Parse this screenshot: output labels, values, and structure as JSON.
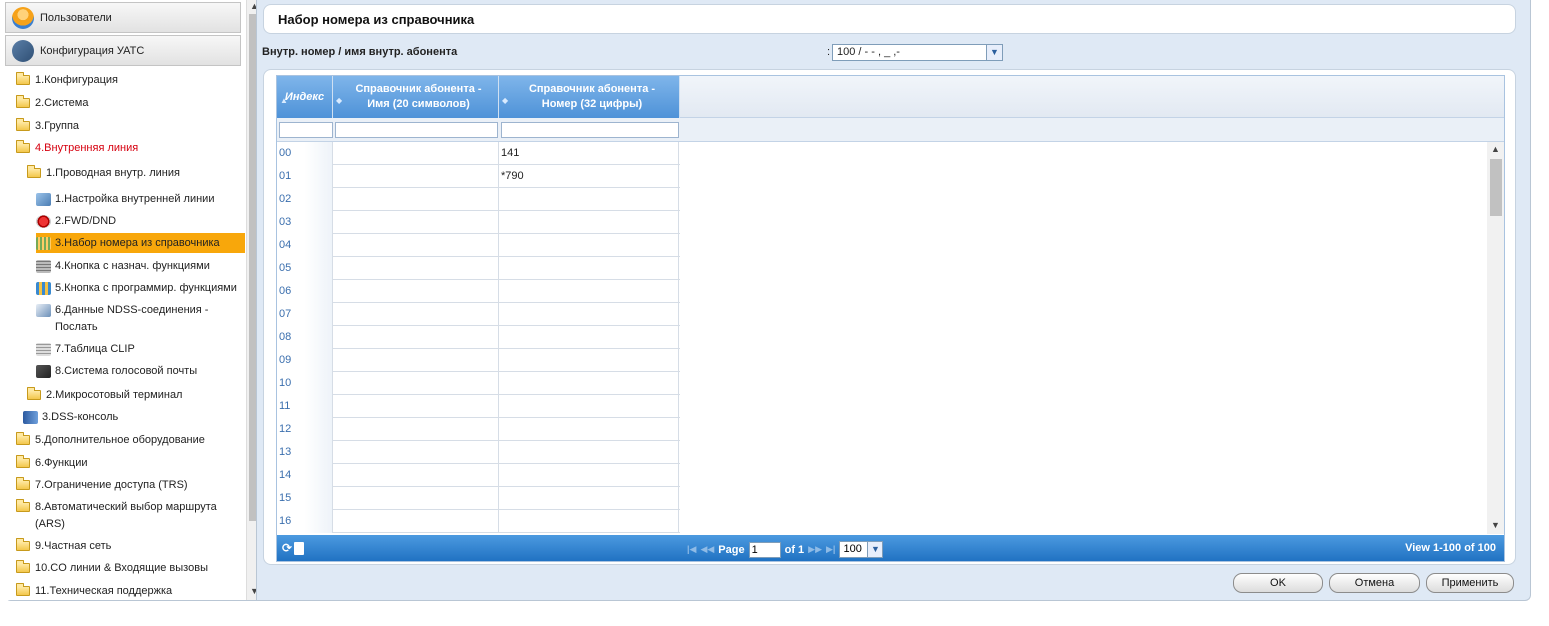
{
  "sidebar": {
    "users_label": "Пользователи",
    "config_label": "Конфигурация УАТС",
    "items": [
      {
        "label": "1.Конфигурация"
      },
      {
        "label": "2.Система"
      },
      {
        "label": "3.Группа"
      },
      {
        "label": "4.Внутренняя линия"
      },
      {
        "label": "1.Проводная внутр. линия"
      },
      {
        "label": "1.Настройка внутренней линии"
      },
      {
        "label": "2.FWD/DND"
      },
      {
        "label": "3.Набор номера из справочника"
      },
      {
        "label": "4.Кнопка с назнач. функциями"
      },
      {
        "label": "5.Кнопка с программир. функциями"
      },
      {
        "label": "6.Данные NDSS-соединения -"
      },
      {
        "label": "Послать"
      },
      {
        "label": "7.Таблица CLIP"
      },
      {
        "label": "8.Система голосовой почты"
      },
      {
        "label": "2.Микросотовый терминал"
      },
      {
        "label": "3.DSS-консоль"
      },
      {
        "label": "5.Дополнительное оборудование"
      },
      {
        "label": "6.Функции"
      },
      {
        "label": "7.Ограничение доступа (TRS)"
      },
      {
        "label": "8.Автоматический выбор маршрута"
      },
      {
        "label": "(ARS)"
      },
      {
        "label": "9.Частная сеть"
      },
      {
        "label": "10.CO линии & Входящие вызовы"
      },
      {
        "label": "11.Техническая поддержка"
      }
    ]
  },
  "page": {
    "title": "Набор номера из справочника",
    "ext_label": "Внутр. номер / имя внутр. абонента",
    "ext_colon": ":",
    "ext_value": "100 / - - ,   _ ,-"
  },
  "grid": {
    "col_index": "Индекс",
    "col_name": "Справочник абонента - Имя (20 символов)",
    "col_number": "Справочник абонента - Номер (32 цифры)",
    "rows": [
      {
        "idx": "00",
        "name": "",
        "num": "141"
      },
      {
        "idx": "01",
        "name": "",
        "num": "*790"
      },
      {
        "idx": "02",
        "name": "",
        "num": ""
      },
      {
        "idx": "03",
        "name": "",
        "num": ""
      },
      {
        "idx": "04",
        "name": "",
        "num": ""
      },
      {
        "idx": "05",
        "name": "",
        "num": ""
      },
      {
        "idx": "06",
        "name": "",
        "num": ""
      },
      {
        "idx": "07",
        "name": "",
        "num": ""
      },
      {
        "idx": "08",
        "name": "",
        "num": ""
      },
      {
        "idx": "09",
        "name": "",
        "num": ""
      },
      {
        "idx": "10",
        "name": "",
        "num": ""
      },
      {
        "idx": "11",
        "name": "",
        "num": ""
      },
      {
        "idx": "12",
        "name": "",
        "num": ""
      },
      {
        "idx": "13",
        "name": "",
        "num": ""
      },
      {
        "idx": "14",
        "name": "",
        "num": ""
      },
      {
        "idx": "15",
        "name": "",
        "num": ""
      },
      {
        "idx": "16",
        "name": "",
        "num": ""
      }
    ],
    "pager": {
      "page_label": "Page",
      "page_value": "1",
      "of_label": "of 1",
      "size_value": "100",
      "view_text": "View 1-100 of 100"
    }
  },
  "buttons": {
    "ok": "OK",
    "cancel": "Отмена",
    "apply": "Применить"
  },
  "colors": {
    "accent": "#4e92d8",
    "selected": "#f8a70b",
    "active_red": "#d6000f"
  }
}
